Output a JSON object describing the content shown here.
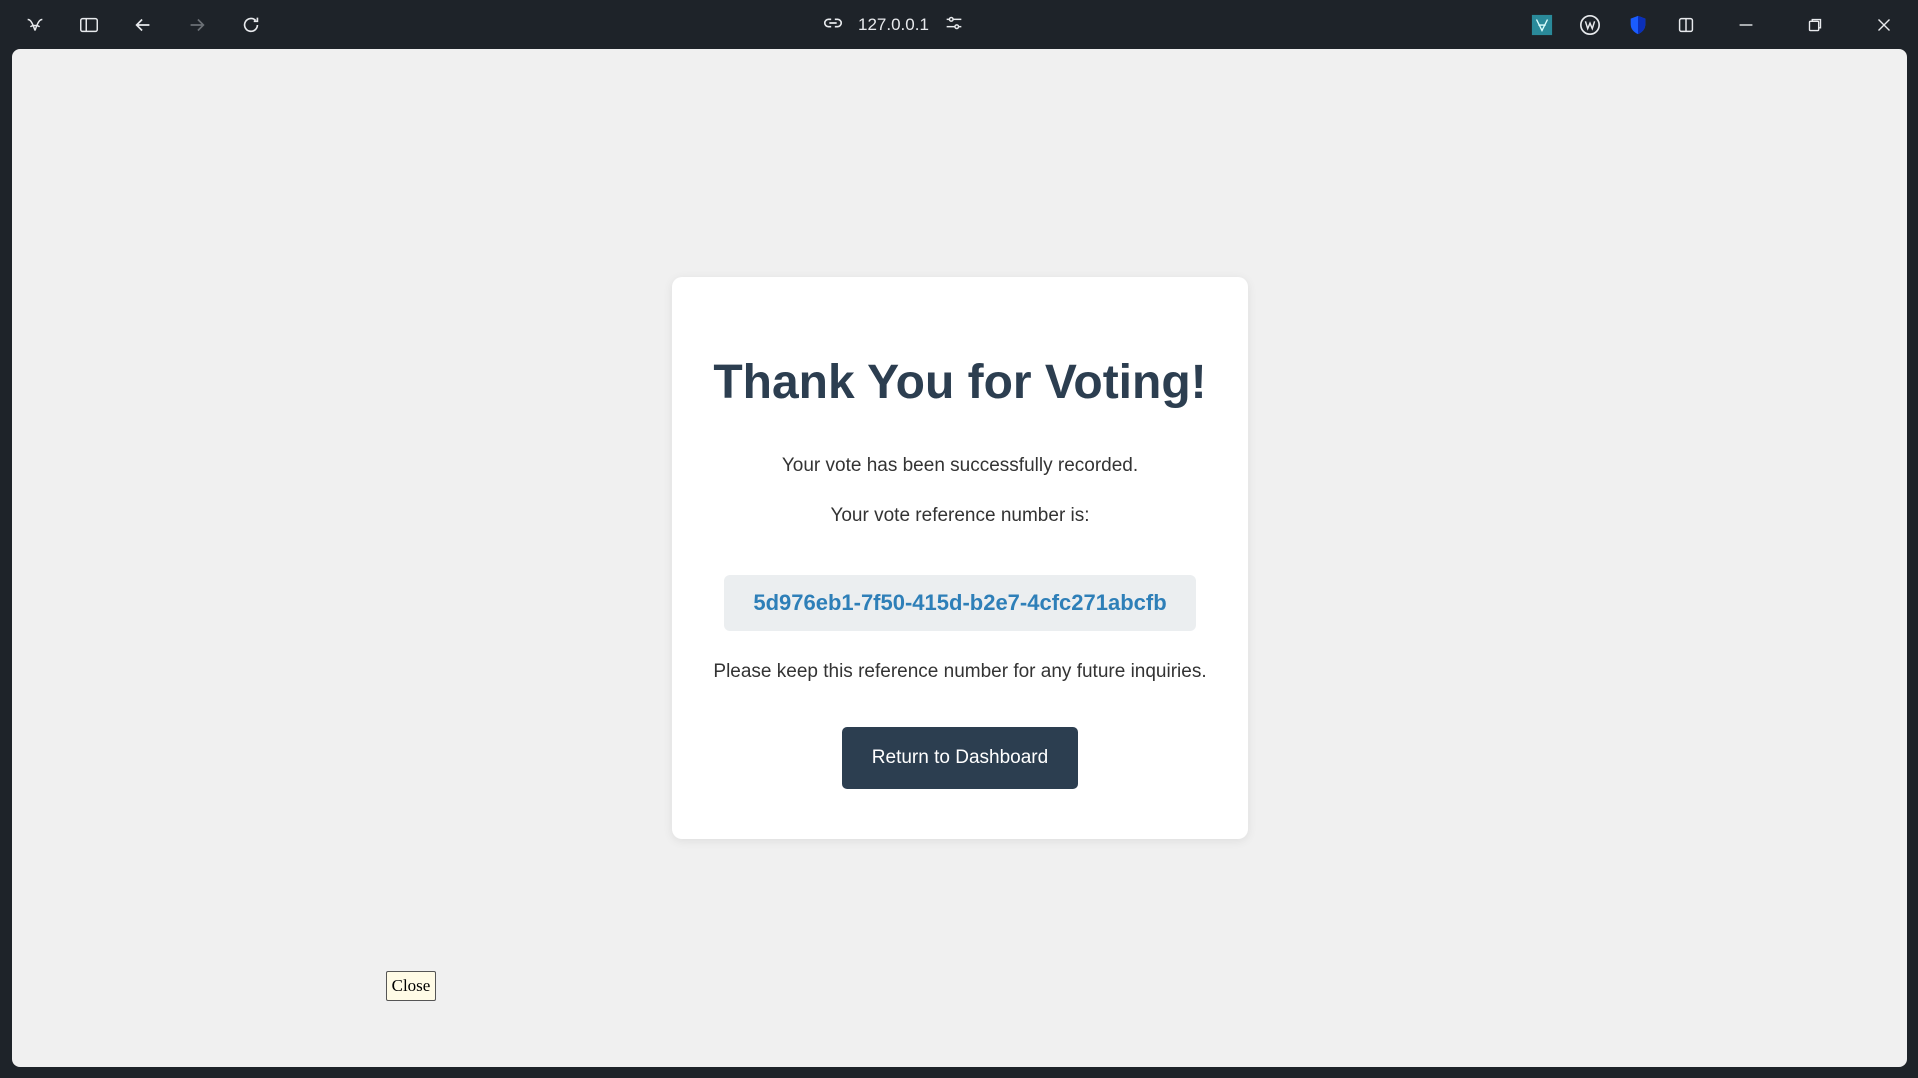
{
  "browser": {
    "address": "127.0.0.1",
    "icons": [
      "app-logo-icon",
      "sidebar-icon",
      "back-icon",
      "forward-icon",
      "reload-icon",
      "link-icon",
      "site-settings-icon",
      "extension-icon",
      "wikipedia-extension-icon",
      "shield-extension-icon",
      "split-view-icon",
      "minimize-icon",
      "restore-icon",
      "close-window-icon"
    ]
  },
  "confirmation": {
    "title": "Thank You for Voting!",
    "success_message": "Your vote has been successfully recorded.",
    "reference_label": "Your vote reference number is:",
    "reference_number": "5d976eb1-7f50-415d-b2e7-4cfc271abcfb",
    "note": "Please keep this reference number for any future inquiries.",
    "button_label": "Return to Dashboard"
  },
  "overlay": {
    "close_label": "Close"
  },
  "colors": {
    "heading": "#2c3e50",
    "reference": "#2e7fb8",
    "button_bg": "#2c3e50",
    "page_bg": "#f0f0f0"
  }
}
